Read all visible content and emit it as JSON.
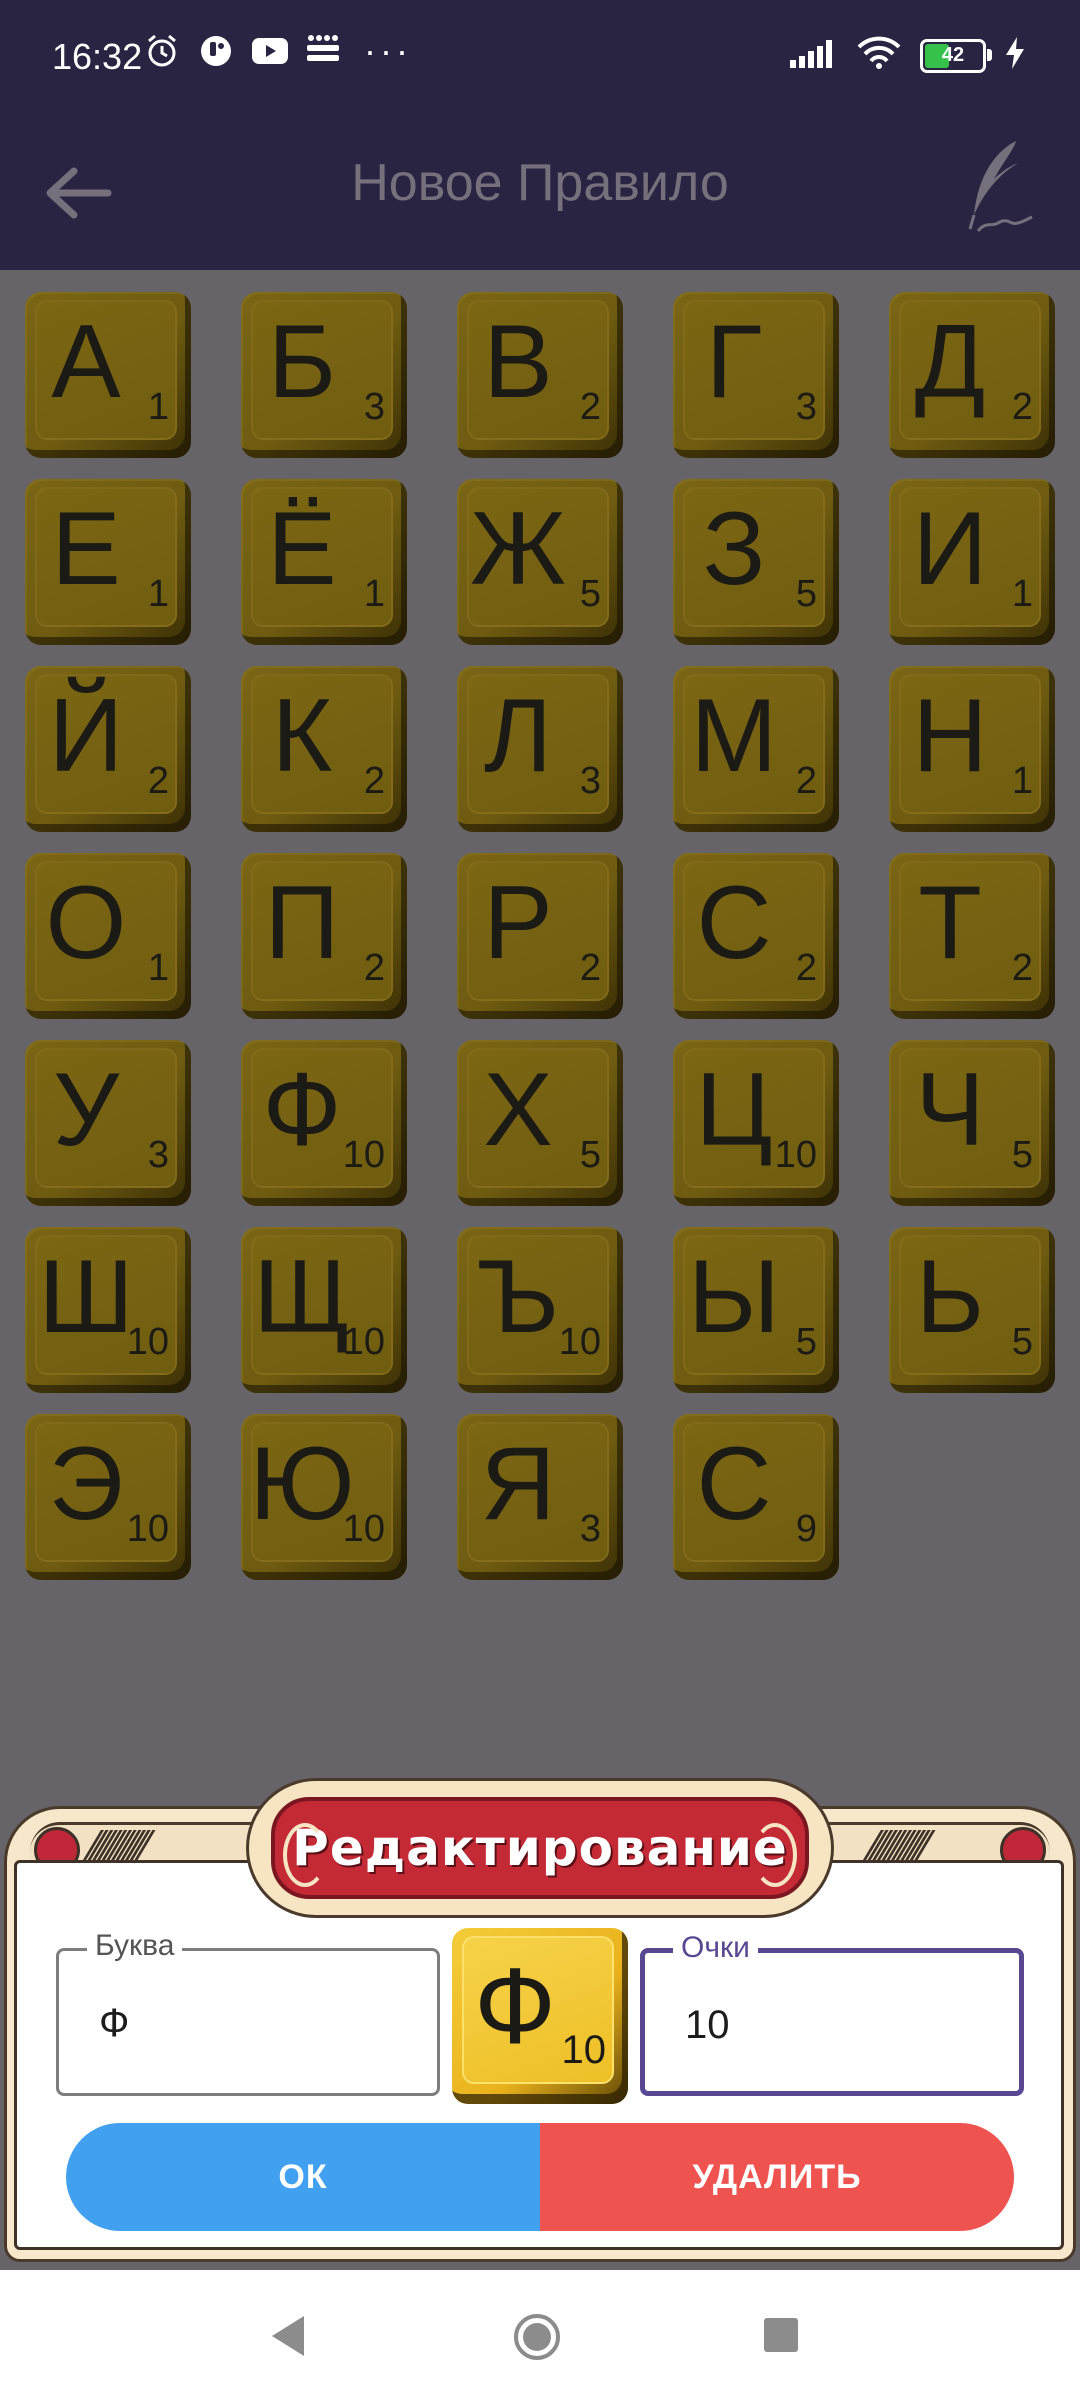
{
  "status_bar": {
    "time": "16:32",
    "left_icons": [
      "alarm-icon",
      "app-badge-icon",
      "youtube-icon",
      "detmir-icon"
    ],
    "more": "···",
    "battery_level": "42",
    "right_icons": [
      "signal-icon",
      "wifi-icon",
      "battery-icon",
      "charging-icon"
    ]
  },
  "toolbar": {
    "title": "Новое Правило",
    "back_icon": "arrow-left-icon",
    "action_icon": "quill-icon"
  },
  "tiles": [
    {
      "letter": "А",
      "score": "1"
    },
    {
      "letter": "Б",
      "score": "3"
    },
    {
      "letter": "В",
      "score": "2"
    },
    {
      "letter": "Г",
      "score": "3"
    },
    {
      "letter": "Д",
      "score": "2"
    },
    {
      "letter": "Е",
      "score": "1"
    },
    {
      "letter": "Ё",
      "score": "1"
    },
    {
      "letter": "Ж",
      "score": "5"
    },
    {
      "letter": "З",
      "score": "5"
    },
    {
      "letter": "И",
      "score": "1"
    },
    {
      "letter": "Й",
      "score": "2"
    },
    {
      "letter": "К",
      "score": "2"
    },
    {
      "letter": "Л",
      "score": "3"
    },
    {
      "letter": "М",
      "score": "2"
    },
    {
      "letter": "Н",
      "score": "1"
    },
    {
      "letter": "О",
      "score": "1"
    },
    {
      "letter": "П",
      "score": "2"
    },
    {
      "letter": "Р",
      "score": "2"
    },
    {
      "letter": "С",
      "score": "2"
    },
    {
      "letter": "Т",
      "score": "2"
    },
    {
      "letter": "У",
      "score": "3"
    },
    {
      "letter": "Ф",
      "score": "10"
    },
    {
      "letter": "Х",
      "score": "5"
    },
    {
      "letter": "Ц",
      "score": "10"
    },
    {
      "letter": "Ч",
      "score": "5"
    },
    {
      "letter": "Ш",
      "score": "10"
    },
    {
      "letter": "Щ",
      "score": "10"
    },
    {
      "letter": "Ъ",
      "score": "10"
    },
    {
      "letter": "Ы",
      "score": "5"
    },
    {
      "letter": "Ь",
      "score": "5"
    },
    {
      "letter": "Э",
      "score": "10"
    },
    {
      "letter": "Ю",
      "score": "10"
    },
    {
      "letter": "Я",
      "score": "3"
    },
    {
      "letter": "С",
      "score": "9"
    }
  ],
  "dialog": {
    "title": "Редактирование",
    "letter_field": {
      "label": "Буква",
      "value": "Ф"
    },
    "points_field": {
      "label": "Очки",
      "value": "10"
    },
    "preview": {
      "letter": "Ф",
      "score": "10"
    },
    "ok_label": "ОК",
    "delete_label": "УДАЛИТЬ"
  },
  "colors": {
    "appbar": "#2a2443",
    "tile": "#7a6514",
    "tile_selected": "#f0c02a",
    "ok": "#42a0f0",
    "delete": "#ef5350",
    "banner": "#c42a36",
    "focus": "#5a4791"
  },
  "navbar": {
    "icons": [
      "nav-back-icon",
      "nav-home-icon",
      "nav-recent-icon"
    ]
  }
}
